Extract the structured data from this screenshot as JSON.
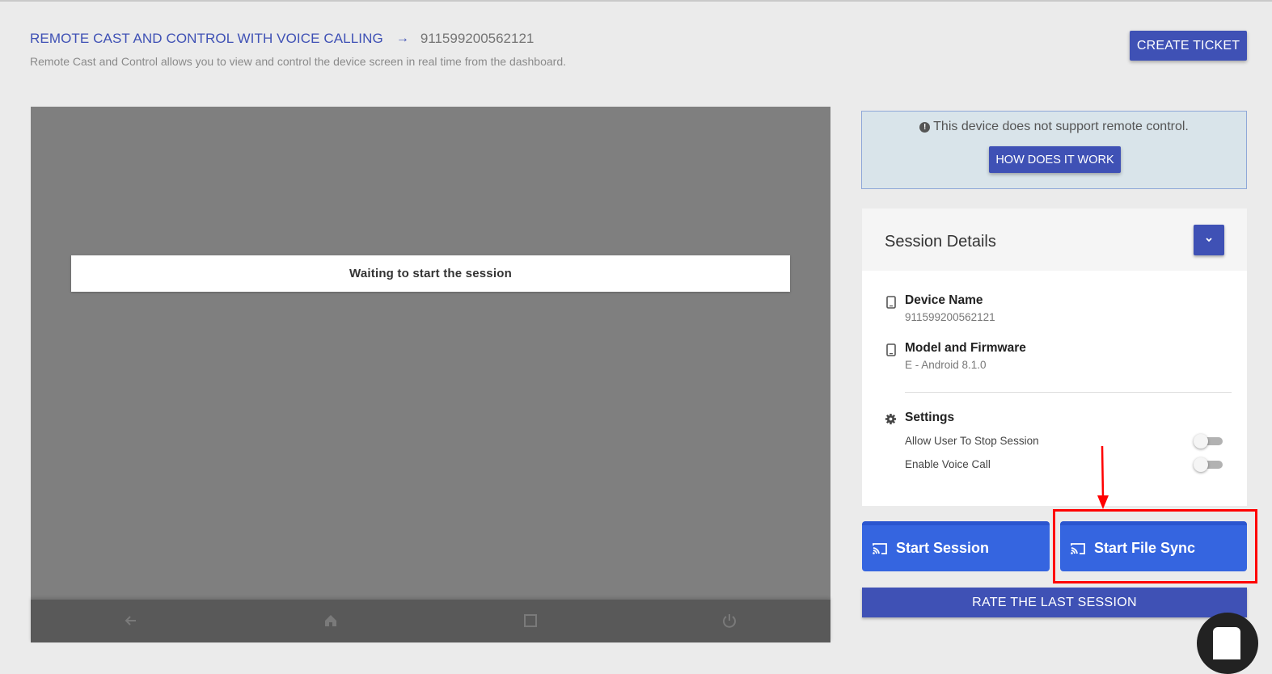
{
  "header": {
    "title": "REMOTE CAST AND CONTROL WITH VOICE CALLING",
    "arrow": "→",
    "device_id": "911599200562121",
    "subtitle": "Remote Cast and Control allows you to view and control the device screen in real time from the dashboard.",
    "create_ticket_label": "CREATE TICKET"
  },
  "screen": {
    "status_text": "Waiting to start the session",
    "nav_icons": [
      "back-icon",
      "home-icon",
      "recents-icon",
      "power-icon"
    ]
  },
  "info": {
    "message": "This device does not support remote control.",
    "how_label": "HOW DOES IT WORK"
  },
  "session": {
    "title": "Session Details",
    "device_name_label": "Device Name",
    "device_name_value": "911599200562121",
    "model_label": "Model and Firmware",
    "model_value": "E - Android 8.1.0",
    "settings_label": "Settings",
    "settings": [
      {
        "label": "Allow User To Stop Session",
        "enabled": false
      },
      {
        "label": "Enable Voice Call",
        "enabled": false
      }
    ]
  },
  "actions": {
    "start_session_label": "Start Session",
    "start_file_sync_label": "Start File Sync",
    "rate_label": "RATE THE LAST SESSION"
  },
  "colors": {
    "primary": "#3f51b5",
    "action_blue": "#3565e0",
    "annotation_red": "#ff0000",
    "screen_gray": "#7f7f7f"
  }
}
